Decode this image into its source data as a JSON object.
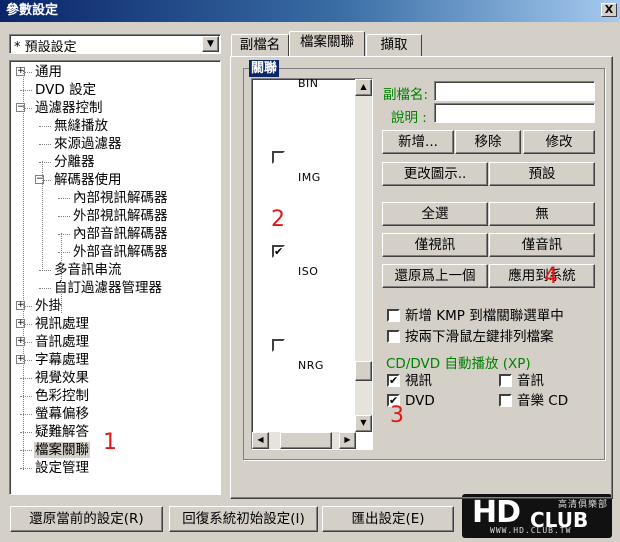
{
  "window": {
    "title": "參數設定",
    "close_glyph": "X"
  },
  "preset": {
    "value": "* 預設設定"
  },
  "tree": {
    "items": [
      {
        "label": "通用",
        "expander": "+"
      },
      {
        "label": "DVD 設定"
      },
      {
        "label": "過濾器控制",
        "expander": "−"
      },
      {
        "label": "無縫播放"
      },
      {
        "label": "來源過濾器"
      },
      {
        "label": "分離器"
      },
      {
        "label": "解碼器使用",
        "expander": "−"
      },
      {
        "label": "內部視訊解碼器"
      },
      {
        "label": "外部視訊解碼器"
      },
      {
        "label": "內部音訊解碼器"
      },
      {
        "label": "外部音訊解碼器"
      },
      {
        "label": "多音訊串流"
      },
      {
        "label": "自訂過濾器管理器"
      },
      {
        "label": "外掛",
        "expander": "+"
      },
      {
        "label": "視訊處理",
        "expander": "+"
      },
      {
        "label": "音訊處理",
        "expander": "+"
      },
      {
        "label": "字幕處理",
        "expander": "+"
      },
      {
        "label": "視覺效果"
      },
      {
        "label": "色彩控制"
      },
      {
        "label": "螢幕偏移"
      },
      {
        "label": "疑難解答"
      },
      {
        "label": "檔案關聯",
        "selected": true
      },
      {
        "label": "設定管理"
      }
    ]
  },
  "tabs": [
    {
      "label": "副檔名"
    },
    {
      "label": "檔案關聯",
      "active": true
    },
    {
      "label": "擷取"
    }
  ],
  "group": {
    "label": "關聯"
  },
  "typelist": {
    "items": [
      {
        "label": "BIN",
        "checked": false,
        "partial": true
      },
      {
        "label": "IMG",
        "checked": false
      },
      {
        "label": "ISO",
        "checked": true
      },
      {
        "label": "NRG",
        "checked": false
      }
    ],
    "check_glyph": "✔",
    "arrow_up": "▲",
    "arrow_down": "▼",
    "arrow_left": "◀",
    "arrow_right": "▶"
  },
  "fields": {
    "ext_label": "副檔名:",
    "ext_value": "",
    "desc_label": "說明 :",
    "desc_value": ""
  },
  "buttons": {
    "add": "新增...",
    "remove": "移除",
    "modify": "修改",
    "change_icon": "更改圖示..",
    "default": "預設",
    "select_all": "全選",
    "none": "無",
    "video_only": "僅視訊",
    "audio_only": "僅音訊",
    "restore_prev": "還原爲上一個",
    "apply_system": "應用到系統"
  },
  "options": {
    "add_kmp_menu": "新增 KMP 到檔關聯選單中",
    "drag_sort": "按兩下滑鼠左鍵排列檔案",
    "cd_dvd_label": "CD/DVD 自動播放 (XP)",
    "video": {
      "label": "視訊",
      "checked": true
    },
    "audio": {
      "label": "音訊",
      "checked": false
    },
    "dvd": {
      "label": "DVD",
      "checked": true
    },
    "music_cd": {
      "label": "音樂 CD",
      "checked": false
    }
  },
  "bottom": {
    "restore_current": "還原當前的設定(R)",
    "restore_initial": "回復系統初始設定(I)",
    "export": "匯出設定(E)"
  },
  "annotations": {
    "n1": "1",
    "n2": "2",
    "n3": "3",
    "n4": "4"
  },
  "logo": {
    "hd": "HD",
    "club": "CLUB",
    "cjk": "高清俱樂部",
    "url": "WWW.HD.CLUB.TW"
  },
  "colors": {
    "title_bar": "#0a246a",
    "group_label": "#0a246a",
    "field_label": "#008000",
    "annotation": "#e01818"
  }
}
